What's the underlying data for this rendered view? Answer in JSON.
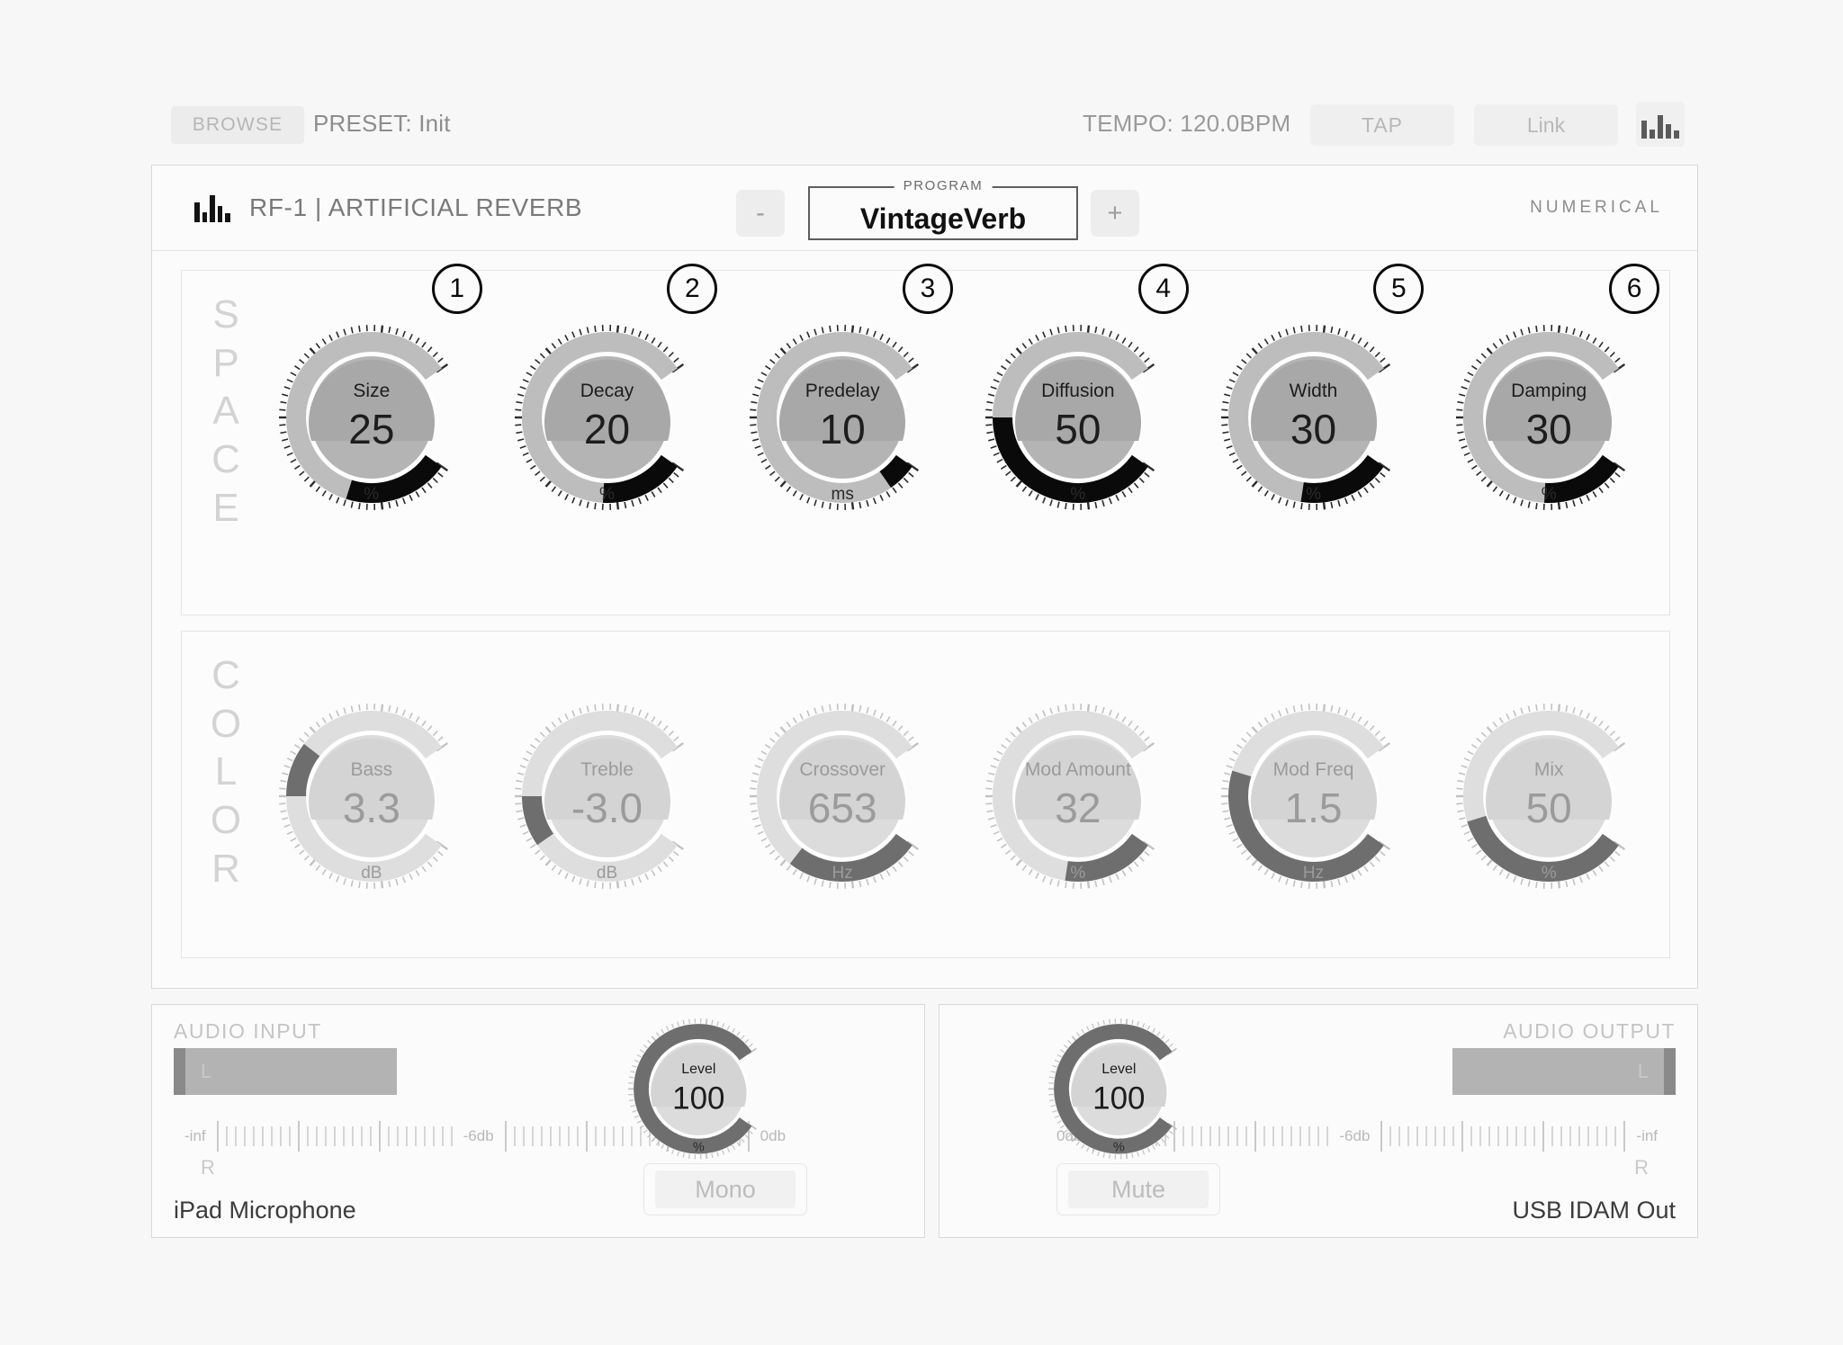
{
  "topbar": {
    "browse_label": "BROWSE",
    "preset_label": "PRESET: Init",
    "tempo_label": "TEMPO: 120.0BPM",
    "tap_label": "TAP",
    "link_label": "Link"
  },
  "plugin": {
    "title": "RF-1 | ARTIFICIAL REVERB",
    "brand": "NUMERICAL",
    "program": {
      "legend": "PROGRAM",
      "value": "VintageVerb",
      "minus_label": "-",
      "plus_label": "+"
    }
  },
  "space_section": {
    "label_letters": [
      "S",
      "P",
      "A",
      "C",
      "E"
    ],
    "knobs": [
      {
        "name": "Size",
        "value": "25",
        "unit": "%",
        "badge": "1",
        "pct": 25
      },
      {
        "name": "Decay",
        "value": "20",
        "unit": "%",
        "badge": "2",
        "pct": 20
      },
      {
        "name": "Predelay",
        "value": "10",
        "unit": "ms",
        "badge": "3",
        "pct": 7
      },
      {
        "name": "Diffusion",
        "value": "50",
        "unit": "%",
        "badge": "4",
        "pct": 50
      },
      {
        "name": "Width",
        "value": "30",
        "unit": "%",
        "badge": "5",
        "pct": 22
      },
      {
        "name": "Damping",
        "value": "30",
        "unit": "%",
        "badge": "6",
        "pct": 20
      }
    ]
  },
  "color_section": {
    "label_letters": [
      "C",
      "O",
      "L",
      "O",
      "R"
    ],
    "knobs": [
      {
        "name": "Bass",
        "value": "3.3",
        "unit": "dB",
        "pct": 63,
        "bipolar": true
      },
      {
        "name": "Treble",
        "value": "-3.0",
        "unit": "dB",
        "pct": 38,
        "bipolar": true
      },
      {
        "name": "Crossover",
        "value": "653",
        "unit": "Hz",
        "pct": 32,
        "bipolar": false
      },
      {
        "name": "Mod Amount",
        "value": "32",
        "unit": "%",
        "pct": 22,
        "bipolar": false
      },
      {
        "name": "Mod Freq",
        "value": "1.5",
        "unit": "Hz",
        "pct": 56,
        "bipolar": false
      },
      {
        "name": "Mix",
        "value": "50",
        "unit": "%",
        "pct": 44,
        "bipolar": false
      }
    ]
  },
  "audio_input": {
    "title": "AUDIO INPUT",
    "channel_l": "L",
    "channel_r": "R",
    "device": "iPad Microphone",
    "scale_left": "-inf",
    "scale_mid": "-6db",
    "scale_right": "0db",
    "level_knob": {
      "name": "Level",
      "value": "100",
      "unit": "%",
      "pct": 100
    },
    "button_label": "Mono"
  },
  "audio_output": {
    "title": "AUDIO OUTPUT",
    "channel_l": "L",
    "channel_r": "R",
    "device": "USB IDAM Out",
    "scale_left": "0db",
    "scale_mid": "-6db",
    "scale_right": "-inf",
    "level_knob": {
      "name": "Level",
      "value": "100",
      "unit": "%",
      "pct": 100
    },
    "button_label": "Mute"
  },
  "colors": {
    "accent_active": "#0a0a0a",
    "accent_inactive": "#6e6e6e",
    "knob_face_space": "#b4b4b4",
    "knob_face_color": "#dcdcdc",
    "panel_bg": "#fbfbfb"
  }
}
